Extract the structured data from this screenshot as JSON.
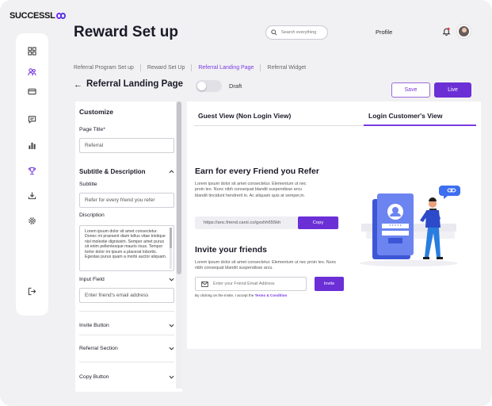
{
  "brand": {
    "logo_text": "SUCCESSL",
    "accent": "#6b2fd6"
  },
  "sidebar": {
    "items": [
      {
        "icon": "dashboard-icon"
      },
      {
        "icon": "users-icon"
      },
      {
        "icon": "card-icon"
      },
      {
        "icon": "chat-icon"
      },
      {
        "icon": "bar-chart-icon"
      },
      {
        "icon": "trophy-icon"
      },
      {
        "icon": "download-icon"
      },
      {
        "icon": "gear-icon"
      },
      {
        "icon": "logout-icon"
      }
    ]
  },
  "header": {
    "title": "Reward Set up",
    "search_placeholder": "Search everything",
    "profile_label": "Profile"
  },
  "breadcrumbs": [
    {
      "label": "Referral Program Set up",
      "active": false
    },
    {
      "label": "Reward Set Up",
      "active": false
    },
    {
      "label": "Referral Landing Page",
      "active": true
    },
    {
      "label": "Referral Widget",
      "active": false
    }
  ],
  "subheader": {
    "back_icon": "arrow-left-icon",
    "title": "Referral Landing Page",
    "toggle_state": "off",
    "status_label": "Draft",
    "save_label": "Save",
    "live_label": "Live"
  },
  "customize": {
    "heading": "Customize",
    "page_title_label": "Page Title*",
    "page_title_value": "Referral",
    "subtitle_section": "Subtitle & Description",
    "subtitle_label": "Subtitle",
    "subtitle_value": "Refer for every friend you refer",
    "description_label": "Discription",
    "description_value": "Lorem ipsum dolor sit amet consectetur. Donec mi praesent diam tellus vitae tristique nisl molestie dignissim. Semper amet purus sit enim pellentesque mauris risus. Tempor tortor dolor mi ipsum a placerat lobortis. Egestas purus quam a morbi auctor aliquam.",
    "input_field_label": "Input Field",
    "input_field_placeholder": "Enter friend's email address",
    "invite_button_label": "Invite Button",
    "referral_section_label": "Referral Section",
    "copy_button_label": "Copy Button"
  },
  "preview": {
    "tabs": [
      {
        "label": "Guest View (Non Login View)",
        "active": false
      },
      {
        "label": "Login Customer's View",
        "active": true
      }
    ],
    "earn_heading": "Earn for every Friend you Refer",
    "earn_text": "Lorem ipsum dolor sit amet consectetur. Elementum ut nec proin leo. Nunc nibh consequat blandit suspendisse arcu blandit tincidunt hendrerit in. Ac aliquam quis at semper,in.",
    "referral_link": "https://anc.friend.carsl.co/gxshh655kh",
    "copy_label": "Copy",
    "invite_heading": "Invite your friends",
    "invite_text": "Lorem ipsum dolor sit amet consectetur. Elementum ut nec proin leo. Nunc nibh consequat blandit suspendisse arcu.",
    "email_placeholder": "Enter your Friend Email Address",
    "invite_label": "Invite",
    "terms_prefix": "By clicking on the Invite, I accept the",
    "terms_link": "Terms & Condition"
  }
}
